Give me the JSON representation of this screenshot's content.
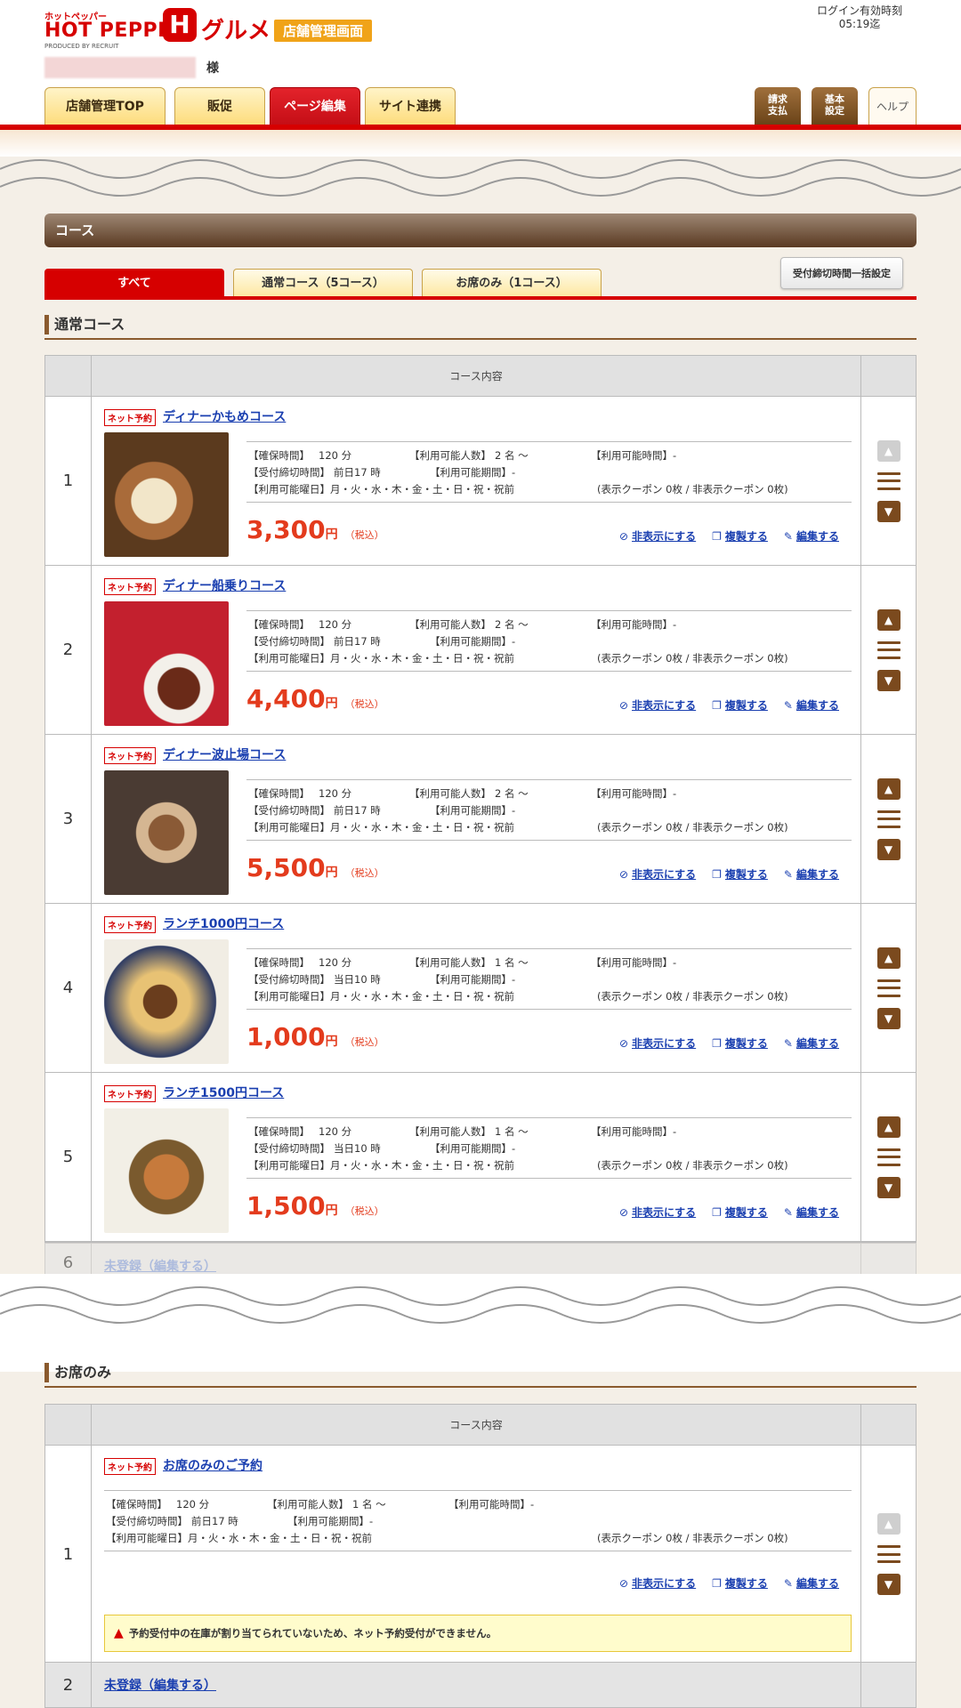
{
  "header": {
    "logo_small": "ホットペッパー",
    "logo_main": "HOT PEPPER",
    "logo_sub": "PRODUCED BY RECRUIT",
    "logo_h": "H",
    "logo_gurume": "グルメ",
    "shop_badge": "店舗管理画面",
    "login_label": "ログイン有効時刻",
    "login_time": "05:19迄",
    "user_suffix": "様"
  },
  "nav": {
    "tabs": [
      "店舗管理TOP",
      "販促",
      "ページ編集",
      "サイト連携"
    ],
    "active": "ページ編集",
    "right_buttons": [
      "請求\n支払",
      "基本\n設定"
    ],
    "help": "ヘルプ"
  },
  "section": {
    "title": "コース"
  },
  "filters": {
    "tabs": [
      "すべて",
      "通常コース（5コース）",
      "お席のみ（1コース）"
    ],
    "deadline_button": "受付締切時間一括設定"
  },
  "normal": {
    "heading": "通常コース",
    "col_header": "コース内容",
    "labels": {
      "net": "ネット予約",
      "hold": "【確保時間】",
      "people": "【利用可能人数】",
      "time": "【利用可能時間】",
      "deadline": "【受付締切時間】",
      "period": "【利用可能期間】",
      "days": "【利用可能曜日】",
      "yen": "円",
      "tax": "（税込）",
      "hide": "非表示にする",
      "copy": "複製する",
      "edit": "編集する"
    },
    "courses": [
      {
        "num": "1",
        "name": "ディナーかもめコース",
        "hold": "120 分",
        "people": "2 名 〜",
        "time": "-",
        "deadline": "前日17 時",
        "period": "-",
        "days": "月・火・水・木・金・土・日・祝・祝前",
        "coupon": "(表示クーポン 0枚 / 非表示クーポン 0枚)",
        "price": "3,300"
      },
      {
        "num": "2",
        "name": "ディナー船乗りコース",
        "hold": "120 分",
        "people": "2 名 〜",
        "time": "-",
        "deadline": "前日17 時",
        "period": "-",
        "days": "月・火・水・木・金・土・日・祝・祝前",
        "coupon": "(表示クーポン 0枚 / 非表示クーポン 0枚)",
        "price": "4,400"
      },
      {
        "num": "3",
        "name": "ディナー波止場コース",
        "hold": "120 分",
        "people": "2 名 〜",
        "time": "-",
        "deadline": "前日17 時",
        "period": "-",
        "days": "月・火・水・木・金・土・日・祝・祝前",
        "coupon": "(表示クーポン 0枚 / 非表示クーポン 0枚)",
        "price": "5,500"
      },
      {
        "num": "4",
        "name": "ランチ1000円コース",
        "hold": "120 分",
        "people": "1 名 〜",
        "time": "-",
        "deadline": "当日10 時",
        "period": "-",
        "days": "月・火・水・木・金・土・日・祝・祝前",
        "coupon": "(表示クーポン 0枚 / 非表示クーポン 0枚)",
        "price": "1,000"
      },
      {
        "num": "5",
        "name": "ランチ1500円コース",
        "hold": "120 分",
        "people": "1 名 〜",
        "time": "-",
        "deadline": "当日10 時",
        "period": "-",
        "days": "月・火・水・木・金・土・日・祝・祝前",
        "coupon": "(表示クーポン 0枚 / 非表示クーポン 0枚)",
        "price": "1,500"
      }
    ],
    "unregistered": {
      "num": "6",
      "label": "未登録（編集する）"
    }
  },
  "seat": {
    "heading": "お席のみ",
    "col_header": "コース内容",
    "course": {
      "num": "1",
      "name": "お席のみのご予約",
      "hold": "120 分",
      "people": "1 名 〜",
      "time": "-",
      "deadline": "前日17 時",
      "period": "-",
      "days": "月・火・水・木・金・土・日・祝・祝前",
      "coupon": "(表示クーポン 0枚 / 非表示クーポン 0枚)"
    },
    "warning": "予約受付中の在庫が割り当てられていないため、ネット予約受付ができません。",
    "unregistered": {
      "num": "2",
      "label": "未登録（編集する）"
    }
  },
  "colors": {
    "brand_red": "#d60000",
    "accent_orange": "#f0a319",
    "brown": "#7b4a1e",
    "link": "#1a3fb0",
    "price": "#e33b1d"
  }
}
